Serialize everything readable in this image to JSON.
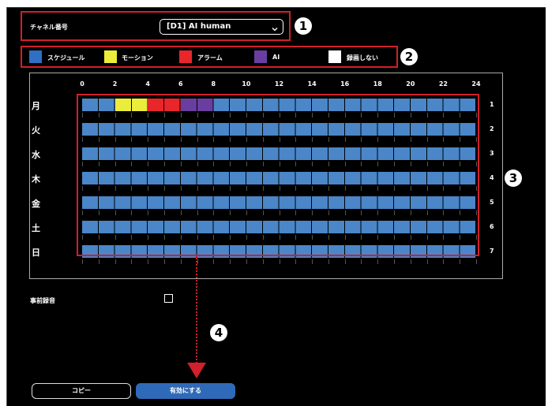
{
  "channel": {
    "label": "チャネル番号",
    "selected": "[D1] AI human"
  },
  "legend": [
    {
      "label": "スケジュール",
      "color": "#2f6fc4"
    },
    {
      "label": "モーション",
      "color": "#ecec3a"
    },
    {
      "label": "アラーム",
      "color": "#e8262b"
    },
    {
      "label": "AI",
      "color": "#6a3ea0"
    },
    {
      "label": "録画しない",
      "color": "#ffffff"
    }
  ],
  "schedule": {
    "hours": [
      "0",
      "2",
      "4",
      "6",
      "8",
      "10",
      "12",
      "14",
      "16",
      "18",
      "20",
      "22",
      "24"
    ],
    "days": [
      "月",
      "火",
      "水",
      "木",
      "金",
      "土",
      "日"
    ],
    "row_numbers": [
      "1",
      "2",
      "3",
      "4",
      "5",
      "6",
      "7"
    ],
    "monday_overrides": [
      {
        "type": "motion",
        "from_hour": 2,
        "to_hour": 4,
        "color": "#ecec3a"
      },
      {
        "type": "alarm",
        "from_hour": 4,
        "to_hour": 6,
        "color": "#e8262b"
      },
      {
        "type": "ai",
        "from_hour": 6,
        "to_hour": 8,
        "color": "#6a3ea0"
      }
    ]
  },
  "pre_record": {
    "label": "事前録音",
    "checked": false
  },
  "buttons": {
    "copy": "コピー",
    "enable": "有効にする"
  },
  "annotations": {
    "badge1": "1",
    "badge2": "2",
    "badge3": "3",
    "badge4": "4"
  }
}
